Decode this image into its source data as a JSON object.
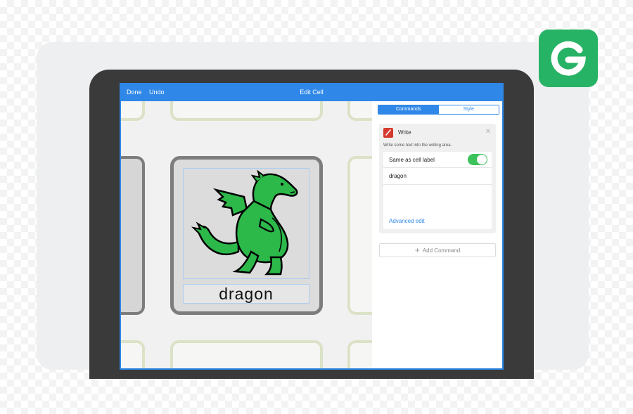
{
  "toolbar": {
    "done_label": "Done",
    "undo_label": "Undo",
    "title": "Edit Cell"
  },
  "tabs": [
    {
      "label": "Commands",
      "active": true
    },
    {
      "label": "Style",
      "active": false
    }
  ],
  "cell": {
    "label": "dragon"
  },
  "command": {
    "name": "Write",
    "description": "Write some text into the writing area.",
    "same_as_label_text": "Same as cell label",
    "same_as_label_on": true,
    "value": "dragon",
    "advanced_edit_label": "Advanced edit"
  },
  "add_command_label": "Add Command",
  "colors": {
    "accent": "#2f88e8",
    "toggle_on": "#3cc25a",
    "logo": "#27b365",
    "dragon": "#2db84a"
  },
  "icons": {
    "logo": "g-logo-icon",
    "write": "pencil-icon",
    "close": "close-icon",
    "add": "plus-icon"
  }
}
